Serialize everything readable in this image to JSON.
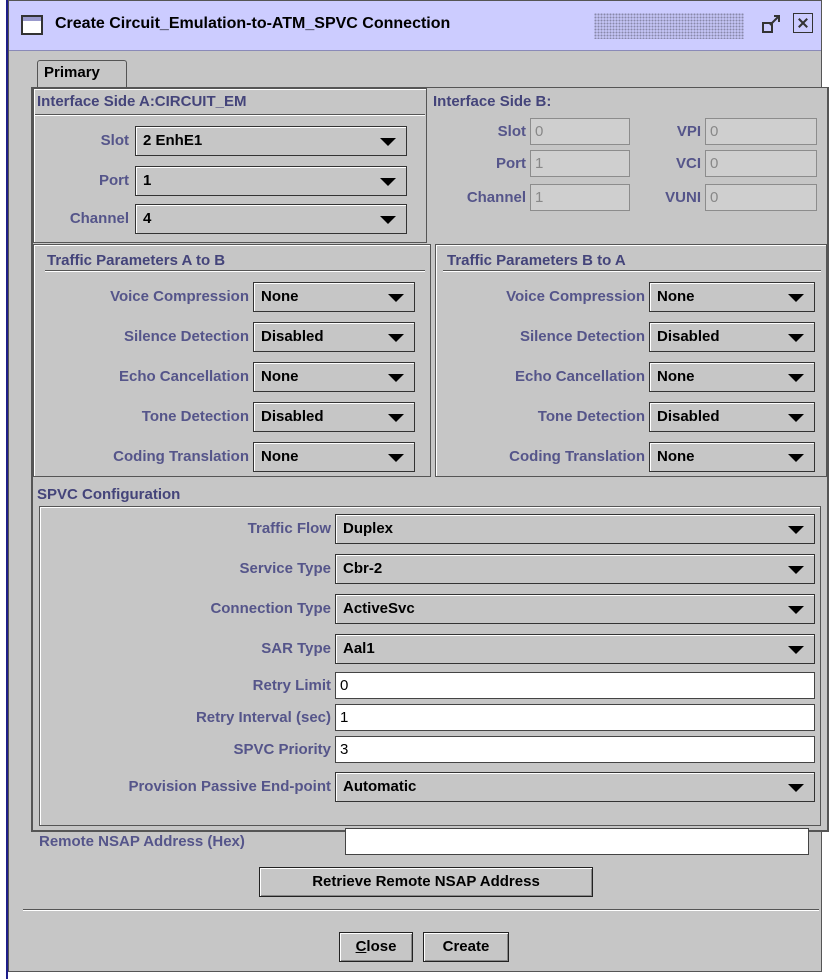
{
  "window": {
    "title": "Create Circuit_Emulation-to-ATM_SPVC Connection"
  },
  "tabs": [
    {
      "label": "Primary"
    }
  ],
  "side_a": {
    "title": "Interface Side A:CIRCUIT_EM",
    "slot_label": "Slot",
    "slot_value": "2 EnhE1",
    "port_label": "Port",
    "port_value": "1",
    "channel_label": "Channel",
    "channel_value": "4"
  },
  "side_b": {
    "title": "Interface Side B:",
    "slot_label": "Slot",
    "slot_value": "0",
    "port_label": "Port",
    "port_value": "1",
    "channel_label": "Channel",
    "channel_value": "1",
    "vpi_label": "VPI",
    "vpi_value": "0",
    "vci_label": "VCI",
    "vci_value": "0",
    "vuni_label": "VUNI",
    "vuni_value": "0"
  },
  "traffic_a_to_b": {
    "title": "Traffic Parameters A to B",
    "rows": [
      {
        "label": "Voice Compression",
        "value": "None"
      },
      {
        "label": "Silence Detection",
        "value": "Disabled"
      },
      {
        "label": "Echo Cancellation",
        "value": "None"
      },
      {
        "label": "Tone Detection",
        "value": "Disabled"
      },
      {
        "label": "Coding Translation",
        "value": "None"
      }
    ]
  },
  "traffic_b_to_a": {
    "title": "Traffic Parameters B to A",
    "rows": [
      {
        "label": "Voice Compression",
        "value": "None"
      },
      {
        "label": "Silence Detection",
        "value": "Disabled"
      },
      {
        "label": "Echo Cancellation",
        "value": "None"
      },
      {
        "label": "Tone Detection",
        "value": "Disabled"
      },
      {
        "label": "Coding Translation",
        "value": "None"
      }
    ]
  },
  "spvc": {
    "title": "SPVC Configuration",
    "traffic_flow_label": "Traffic Flow",
    "traffic_flow_value": "Duplex",
    "service_type_label": "Service Type",
    "service_type_value": "Cbr-2",
    "connection_type_label": "Connection Type",
    "connection_type_value": "ActiveSvc",
    "sar_type_label": "SAR Type",
    "sar_type_value": "Aal1",
    "retry_limit_label": "Retry Limit",
    "retry_limit_value": "0",
    "retry_interval_label": "Retry Interval (sec)",
    "retry_interval_value": "1",
    "priority_label": "SPVC Priority",
    "priority_value": "3",
    "passive_label": "Provision Passive End-point",
    "passive_value": "Automatic",
    "nsap_label": "Remote NSAP Address (Hex)",
    "nsap_value": "",
    "retrieve_label": "Retrieve Remote NSAP Address"
  },
  "footer": {
    "close_label": "Close",
    "close_mnemonic": "C",
    "close_rest": "lose",
    "create_label": "Create"
  },
  "colors": {
    "titlebar": "#ccccff",
    "window_bg": "#c6c6c6",
    "label": "#55558a",
    "group_title": "#44447a"
  }
}
